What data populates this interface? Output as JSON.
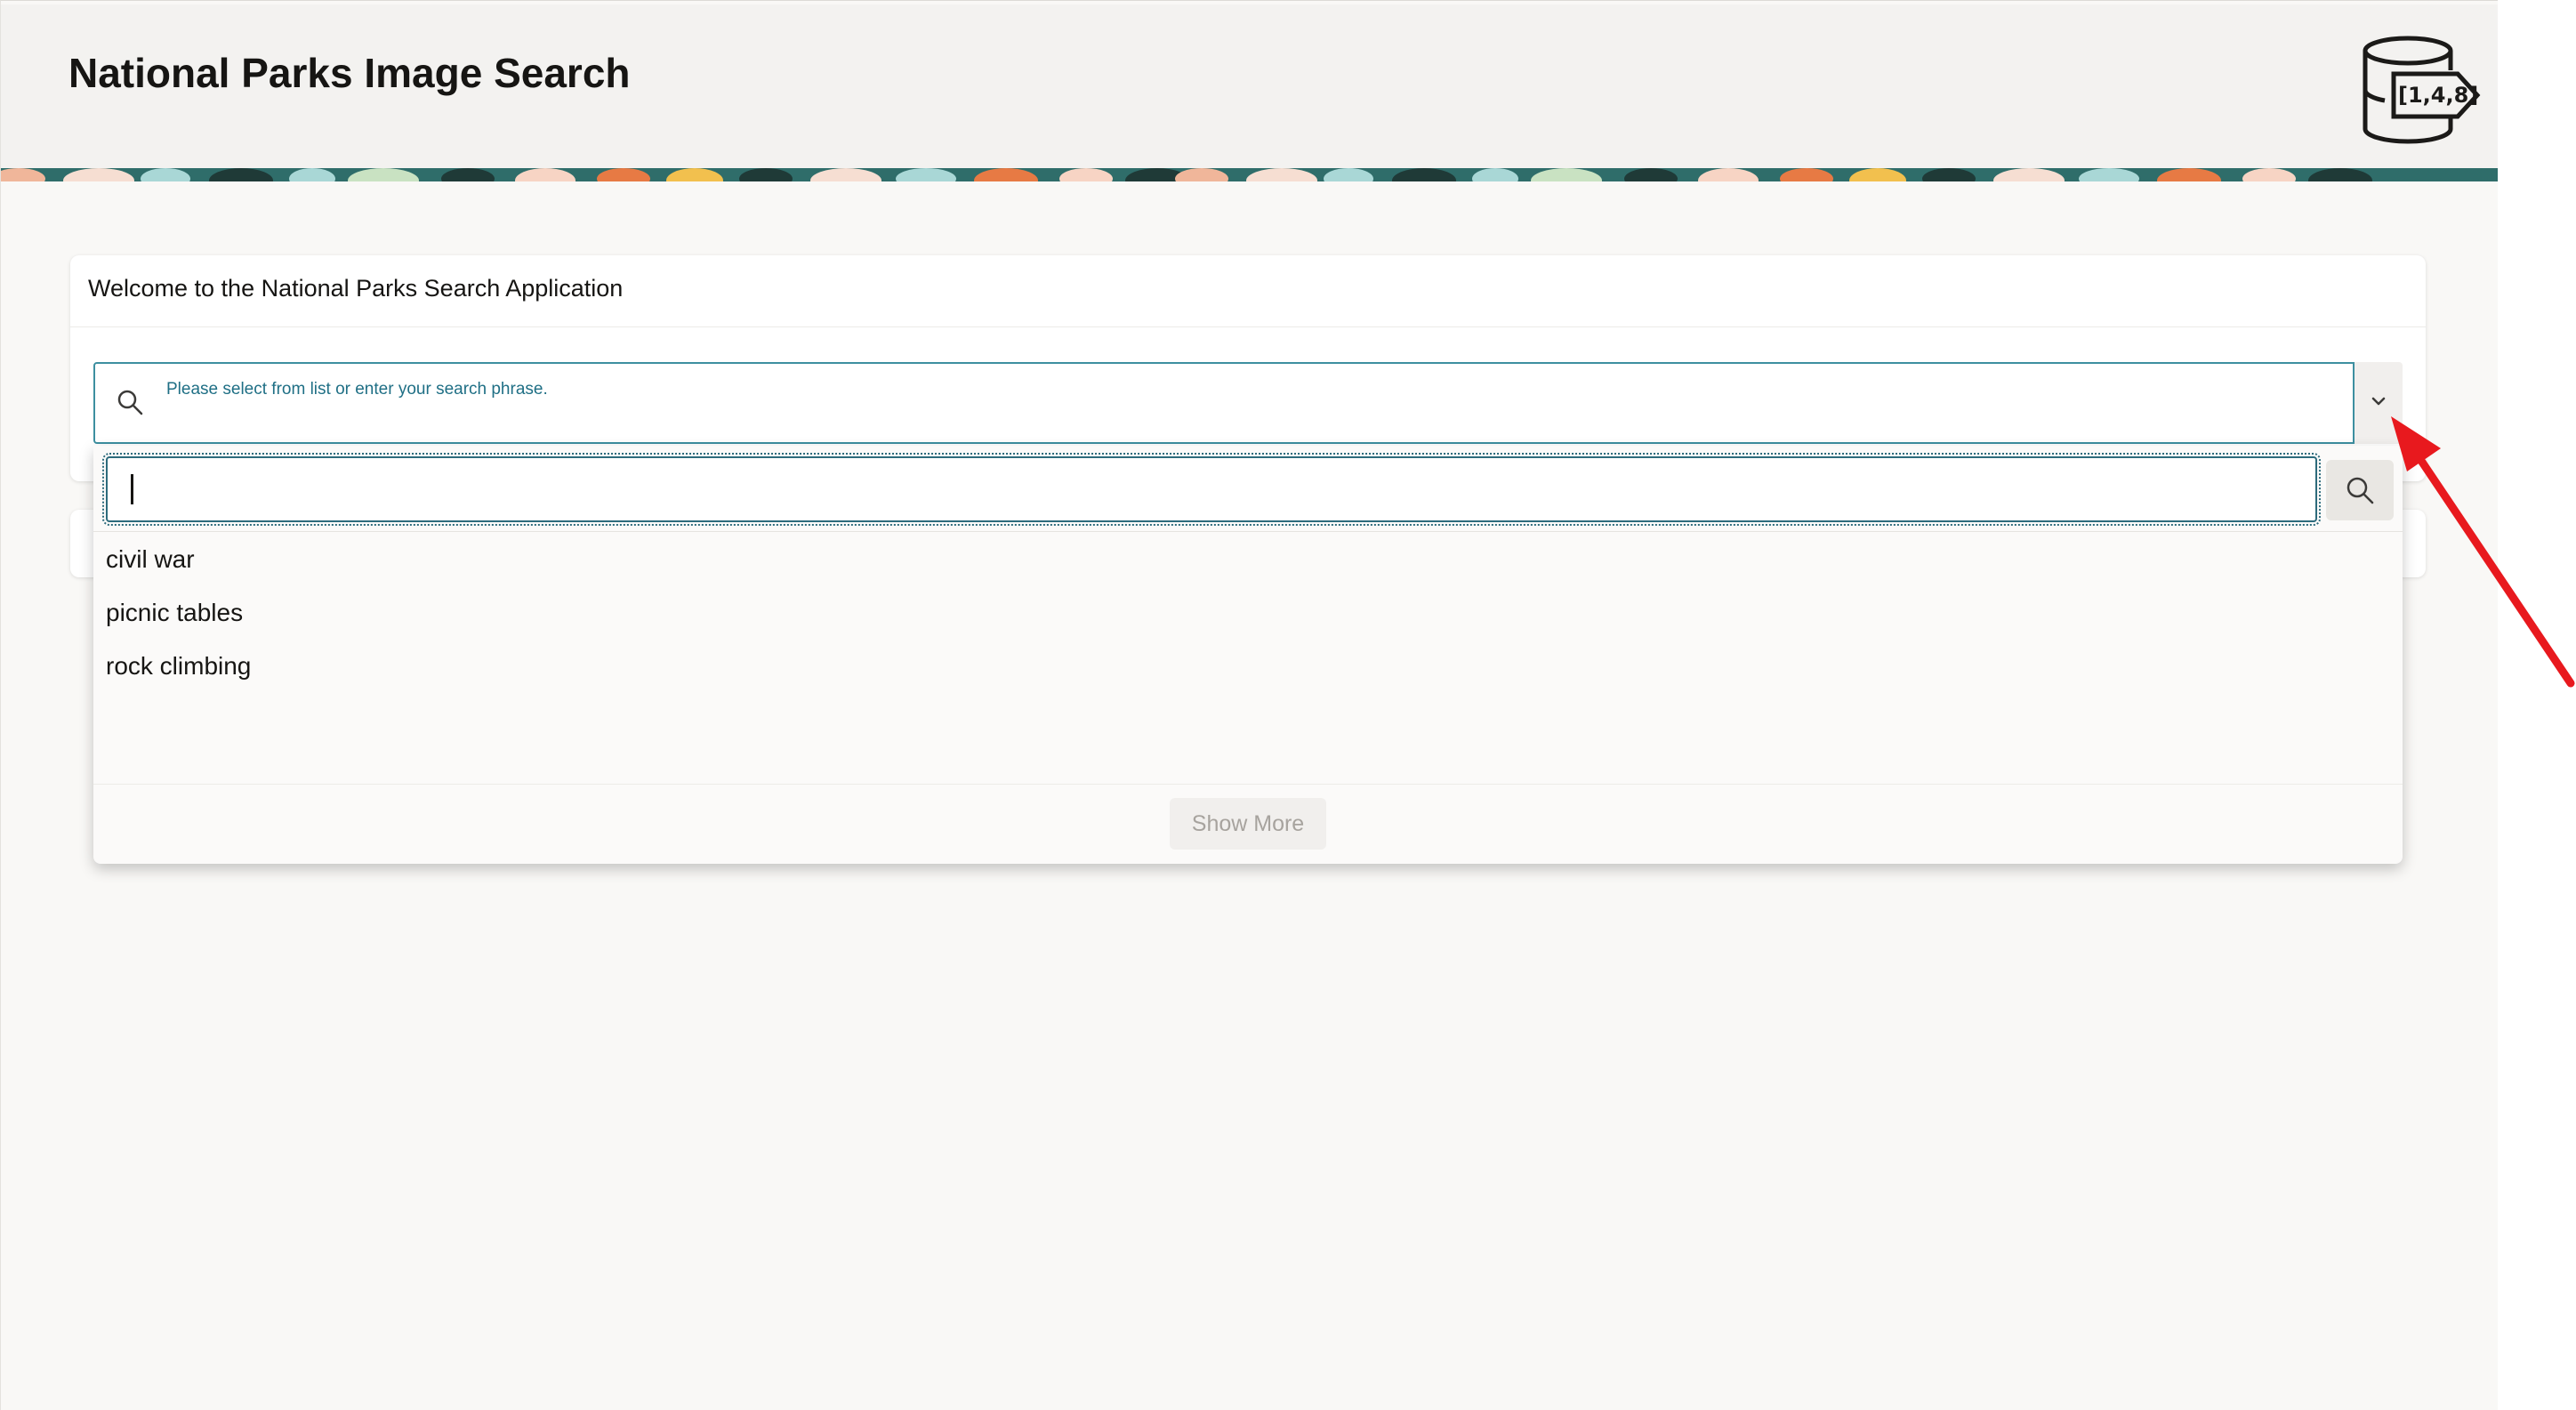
{
  "header": {
    "title": "National Parks Image Search",
    "logo_text": "[1,4,8]"
  },
  "welcome_card": {
    "title": "Welcome to the National Parks Search Application"
  },
  "search": {
    "label": "Please select from list or enter your search phrase.",
    "value": "",
    "icon": "search-icon"
  },
  "dropdown": {
    "filter_value": "",
    "options": [
      {
        "label": "civil war"
      },
      {
        "label": "picnic tables"
      },
      {
        "label": "rock climbing"
      }
    ],
    "show_more_label": "Show More"
  },
  "colors": {
    "accent": "#3d8fa0",
    "annotation_arrow": "#e8191e",
    "header_bg": "#f3f2f0",
    "page_bg": "#f9f8f6"
  }
}
